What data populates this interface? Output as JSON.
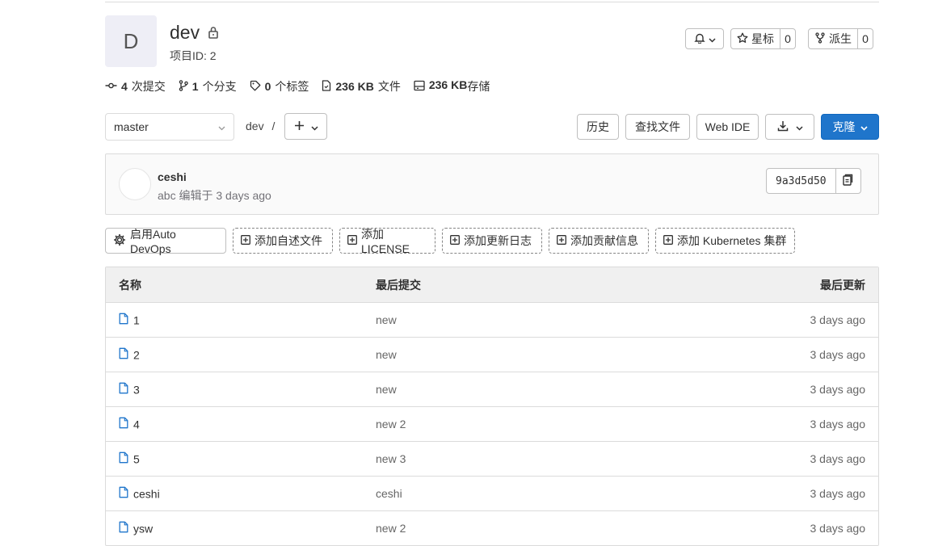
{
  "project": {
    "avatar_letter": "D",
    "name": "dev",
    "id_label": "项目ID: 2"
  },
  "header_actions": {
    "star_label": "星标",
    "star_count": "0",
    "fork_label": "派生",
    "fork_count": "0"
  },
  "stats": {
    "commits_count": "4",
    "commits_label": "次提交",
    "branches_count": "1",
    "branches_label": "个分支",
    "tags_count": "0",
    "tags_label": "个标签",
    "files_size": "236 KB",
    "files_label": "文件",
    "storage_size": "236 KB",
    "storage_label": "存储"
  },
  "toolbar": {
    "branch": "master",
    "path": "dev",
    "path_sep": "/",
    "history": "历史",
    "find_file": "查找文件",
    "web_ide": "Web IDE",
    "clone": "克隆"
  },
  "commit": {
    "author": "ceshi",
    "meta": "abc 编辑于 3 days ago",
    "sha": "9a3d5d50"
  },
  "quick_actions": {
    "auto_devops": "启用Auto DevOps",
    "readme": "添加自述文件",
    "license": "添加LICENSE",
    "changelog": "添加更新日志",
    "contributing": "添加贡献信息",
    "kubernetes": "添加 Kubernetes 集群"
  },
  "table": {
    "headers": {
      "name": "名称",
      "last_commit": "最后提交",
      "last_update": "最后更新"
    },
    "rows": [
      {
        "name": "1",
        "commit": "new",
        "updated": "3 days ago"
      },
      {
        "name": "2",
        "commit": "new",
        "updated": "3 days ago"
      },
      {
        "name": "3",
        "commit": "new",
        "updated": "3 days ago"
      },
      {
        "name": "4",
        "commit": "new 2",
        "updated": "3 days ago"
      },
      {
        "name": "5",
        "commit": "new 3",
        "updated": "3 days ago"
      },
      {
        "name": "ceshi",
        "commit": "ceshi",
        "updated": "3 days ago"
      },
      {
        "name": "ysw",
        "commit": "new 2",
        "updated": "3 days ago"
      }
    ]
  },
  "colors": {
    "accent": "#1f75cb",
    "file_icon": "#1f75cb"
  }
}
